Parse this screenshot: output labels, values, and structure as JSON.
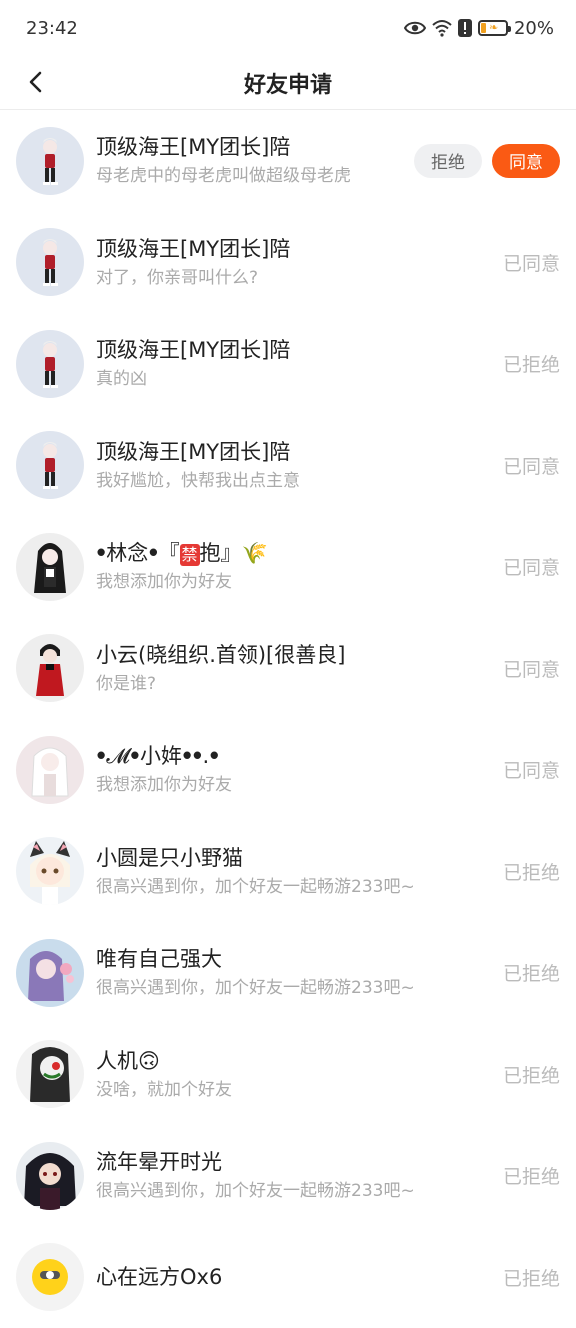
{
  "status_bar": {
    "time": "23:42",
    "battery": "20%",
    "icons": [
      "eye-icon",
      "wifi-icon",
      "alert-icon",
      "battery-icon"
    ]
  },
  "nav": {
    "title": "好友申请",
    "back_icon": "chevron-left-icon"
  },
  "requests": [
    {
      "name": "顶级海王[MY团长]陪",
      "message": "母老虎中的母老虎叫做超级母老虎",
      "status": "",
      "pending": true,
      "reject_label": "拒绝",
      "accept_label": "同意",
      "avatar": "girl-chibi-avatar"
    },
    {
      "name": "顶级海王[MY团长]陪",
      "message": "对了，你亲哥叫什么?",
      "status": "已同意",
      "avatar": "girl-chibi-avatar"
    },
    {
      "name": "顶级海王[MY团长]陪",
      "message": "真的凶",
      "status": "已拒绝",
      "avatar": "girl-chibi-avatar"
    },
    {
      "name": "顶级海王[MY团长]陪",
      "message": "我好尴尬，快帮我出点主意",
      "status": "已同意",
      "avatar": "girl-chibi-avatar"
    },
    {
      "name_prefix": "ꔷ林念ꔷ『",
      "name_badge": "禁",
      "name_suffix": "抱』🌾",
      "message": "我想添加你为好友",
      "status": "已同意",
      "avatar": "dark-hair-girl-avatar"
    },
    {
      "name": "小云(晓组织.首领)[很善良]",
      "message": "你是谁?",
      "status": "已同意",
      "avatar": "red-cloak-avatar"
    },
    {
      "name": "ꔷ𝓜ꔷ小姩ꔷꔷ.ꔷ",
      "message": "我想添加你为好友",
      "status": "已同意",
      "avatar": "white-hair-girl-avatar"
    },
    {
      "name": "小圆是只小野猫",
      "message": "很高兴遇到你，加个好友一起畅游233吧~",
      "status": "已拒绝",
      "avatar": "cat-ear-girl-avatar"
    },
    {
      "name": "唯有自己强大",
      "message": "很高兴遇到你，加个好友一起畅游233吧~",
      "status": "已拒绝",
      "avatar": "pastel-girl-avatar"
    },
    {
      "name": "人机🙃",
      "message": "没啥，就加个好友",
      "status": "已拒绝",
      "avatar": "masked-character-avatar"
    },
    {
      "name": "流年晕开时光",
      "message": "很高兴遇到你，加个好友一起畅游233吧~",
      "status": "已拒绝",
      "avatar": "dark-hair-boy-avatar"
    },
    {
      "name": "心在远方Ox6",
      "message": "",
      "status": "已拒绝",
      "avatar": "yellow-character-avatar"
    }
  ],
  "colors": {
    "accent": "#fa5a14",
    "reject_bg": "#eff0f2",
    "status_text": "#bbbbbb",
    "secondary_text": "#aaaaaa"
  }
}
